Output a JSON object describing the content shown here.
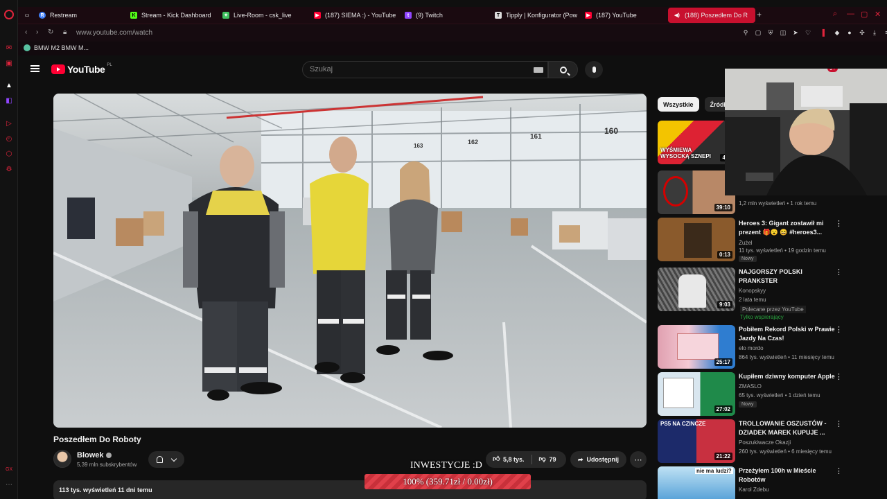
{
  "browser": {
    "tabs": [
      {
        "label": "Restream",
        "icon": "restream-icon",
        "color": "#3f7ef6"
      },
      {
        "label": "Stream - Kick Dashboard",
        "icon": "kick-icon",
        "color": "#53fc18"
      },
      {
        "label": "Live-Room - csk_live",
        "icon": "live-room-icon",
        "color": "#3fbf5f"
      },
      {
        "label": "(187) SIEMA :) - YouTube",
        "icon": "youtube-icon",
        "color": "#ff0033"
      },
      {
        "label": "(9) Twitch",
        "icon": "twitch-icon",
        "color": "#9146ff"
      },
      {
        "label": "Tipply | Konfigurator (Pow",
        "icon": "tipply-icon",
        "color": "#ffffff"
      },
      {
        "label": "(187) YouTube",
        "icon": "youtube-icon",
        "color": "#ff0033"
      },
      {
        "label": "(188) Poszedłem Do R",
        "icon": "youtube-icon",
        "color": "#ff0033"
      }
    ],
    "url": "www.youtube.com/watch",
    "bookmark": "BMW M2 BMW M...",
    "side_footer": "GX"
  },
  "youtube": {
    "logo_text": "YouTube",
    "region": "PL",
    "search_placeholder": "Szukaj",
    "notifications_badge": "9+"
  },
  "video": {
    "title": "Poszedłem Do Roboty",
    "channel": "Blowek",
    "subscribers": "5,39 mln subskrybentów",
    "likes": "5,8 tys.",
    "dislikes": "79",
    "share_label": "Udostępnij",
    "stats": "113 tys. wyświetleń  11 dni temu",
    "scene_signs": [
      "160",
      "161",
      "162",
      "163"
    ]
  },
  "overlay": {
    "label": "INWESTYCJE :D",
    "progress_text": "100% (359.71zł / 0.00zł)",
    "progress_percent": 100
  },
  "sidebar": {
    "chips": [
      "Wszystkie",
      "Źródło"
    ],
    "recommendations": [
      {
        "title": "",
        "channel": "",
        "meta": "",
        "duration": "42:",
        "thumb_text": "WYŚMIEWA WYSOCKĄ SZNEPI"
      },
      {
        "title": "",
        "channel": "",
        "meta": "1,2 mln wyświetleń • 1 rok temu",
        "duration": "39:10",
        "thumb_text": ""
      },
      {
        "title": "Heroes 3: Gigant zostawił mi prezent 🎁😮 😆 #heroes3...",
        "channel": "Żużel",
        "meta": "11 tys. wyświetleń • 19 godzin temu",
        "duration": "0:13",
        "badge": "Nowy",
        "thumb_text": ""
      },
      {
        "title": "NAJGORSZY POLSKI PRANKSTER",
        "channel": "Konopskyy",
        "meta": "2 lata temu",
        "duration": "9:03",
        "promo": "Polecane przez YouTube",
        "members": "Tylko wspierający",
        "thumb_text": ""
      },
      {
        "title": "Pobiłem Rekord Polski w Prawie Jazdy Na Czas!",
        "channel": "elo mordo",
        "meta": "864 tys. wyświetleń • 11 miesięcy temu",
        "duration": "25:17",
        "thumb_text": ""
      },
      {
        "title": "Kupiłem dziwny komputer Apple",
        "channel": "ZMASLO",
        "meta": "65 tys. wyświetleń • 1 dzień temu",
        "duration": "27:02",
        "badge": "Nowy",
        "thumb_text": ""
      },
      {
        "title": "TROLLOWANIE OSZUSTÓW - DZIADEK MAREK KUPUJE ...",
        "channel": "Poszukiwacze Okazji",
        "meta": "260 tys. wyświetleń • 6 miesięcy temu",
        "duration": "21:22",
        "thumb_text": "PS5 NA CZINCZE"
      },
      {
        "title": "Przeżyłem 100h w Mieście Robotów",
        "channel": "Karol Zdebu",
        "meta": "",
        "duration": "",
        "thumb_text": "nie ma ludzi?"
      }
    ]
  }
}
